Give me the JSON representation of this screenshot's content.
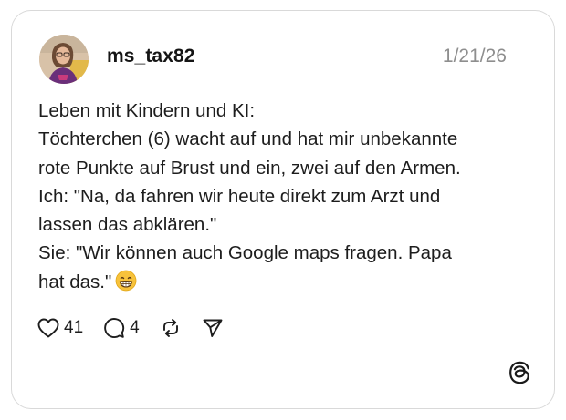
{
  "post": {
    "username": "ms_tax82",
    "date": "1/21/26",
    "lines": [
      "Leben mit Kindern und KI:",
      "Töchterchen (6) wacht auf und hat mir unbekannte",
      "rote Punkte auf Brust und ein, zwei auf den Armen.",
      "Ich: \"Na, da fahren wir heute direkt zum Arzt und",
      "lassen das abklären.\"",
      "Sie: \"Wir können auch Google maps fragen. Papa",
      "hat das.\""
    ],
    "emoji": "grinning-face-with-smiling-eyes"
  },
  "actions": {
    "likes": "41",
    "replies": "4",
    "like_icon": "heart-icon",
    "reply_icon": "speech-bubble-icon",
    "repost_icon": "repost-icon",
    "share_icon": "send-icon"
  },
  "brand": {
    "logo": "threads-logo-icon"
  },
  "colors": {
    "border": "#d9d9d9",
    "text": "#1d1d1d",
    "muted": "#8e8e8e",
    "emoji": "#f7c23b"
  }
}
